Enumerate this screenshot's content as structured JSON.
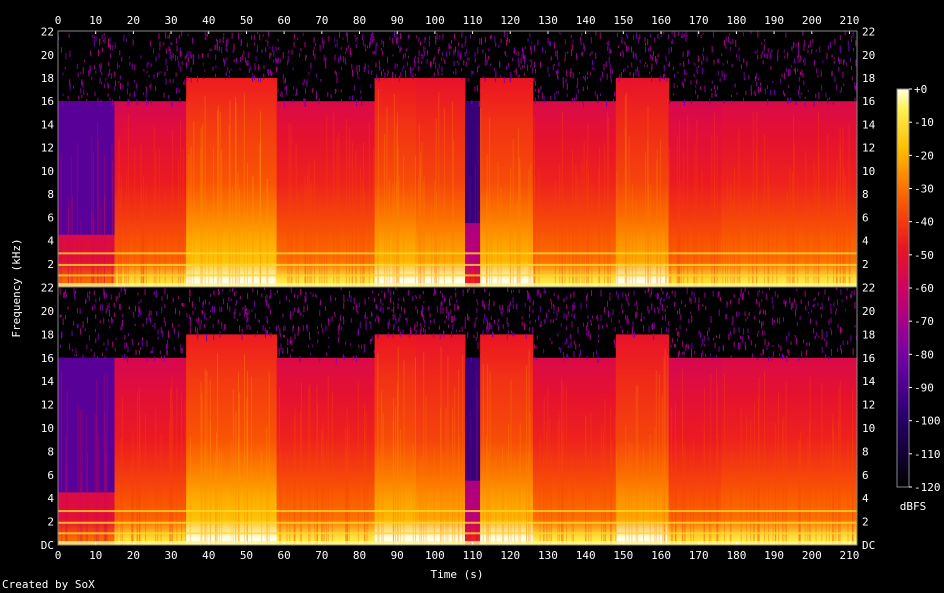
{
  "chart_data": {
    "type": "heatmap",
    "title": "",
    "xlabel": "Time (s)",
    "ylabel": "Frequency (kHz)",
    "x_ticks": [
      "0",
      "10",
      "20",
      "30",
      "40",
      "50",
      "60",
      "70",
      "80",
      "90",
      "100",
      "110",
      "120",
      "130",
      "140",
      "150",
      "160",
      "170",
      "180",
      "190",
      "200",
      "210"
    ],
    "x_range": [
      0,
      212
    ],
    "channels": [
      {
        "name": "",
        "y_ticks": [
          "22",
          "20",
          "18",
          "16",
          "14",
          "12",
          "10",
          "8",
          "6",
          "4",
          "2"
        ],
        "y_range": [
          0,
          22.05
        ]
      },
      {
        "name": "",
        "y_ticks": [
          "22",
          "20",
          "18",
          "16",
          "14",
          "12",
          "10",
          "8",
          "6",
          "4",
          "2",
          "DC"
        ],
        "y_range": [
          0,
          22.05
        ]
      }
    ],
    "colorbar": {
      "label": "dBFS",
      "ticks": [
        "+0",
        "-10",
        "-20",
        "-30",
        "-40",
        "-50",
        "-60",
        "-70",
        "-80",
        "-90",
        "-100",
        "-110",
        "-120"
      ],
      "range": [
        -120,
        0
      ]
    },
    "segments": [
      {
        "t0": 0,
        "t1": 15,
        "level": 0.5,
        "cutoff": 16,
        "low_cut": 4.5
      },
      {
        "t0": 15,
        "t1": 34,
        "level": 0.68,
        "cutoff": 16
      },
      {
        "t0": 34,
        "t1": 46,
        "level": 0.82,
        "cutoff": 18
      },
      {
        "t0": 46,
        "t1": 58,
        "level": 0.82,
        "cutoff": 18
      },
      {
        "t0": 58,
        "t1": 84,
        "level": 0.7,
        "cutoff": 16
      },
      {
        "t0": 84,
        "t1": 95,
        "level": 0.8,
        "cutoff": 18
      },
      {
        "t0": 95,
        "t1": 108,
        "level": 0.78,
        "cutoff": 18
      },
      {
        "t0": 108,
        "t1": 112,
        "level": 0.38,
        "cutoff": 16,
        "low_cut": 5.5
      },
      {
        "t0": 112,
        "t1": 126,
        "level": 0.8,
        "cutoff": 18
      },
      {
        "t0": 126,
        "t1": 148,
        "level": 0.7,
        "cutoff": 16
      },
      {
        "t0": 148,
        "t1": 162,
        "level": 0.78,
        "cutoff": 18
      },
      {
        "t0": 162,
        "t1": 176,
        "level": 0.68,
        "cutoff": 16
      },
      {
        "t0": 176,
        "t1": 212,
        "level": 0.7,
        "cutoff": 16
      }
    ],
    "credit": "Created by SoX"
  }
}
